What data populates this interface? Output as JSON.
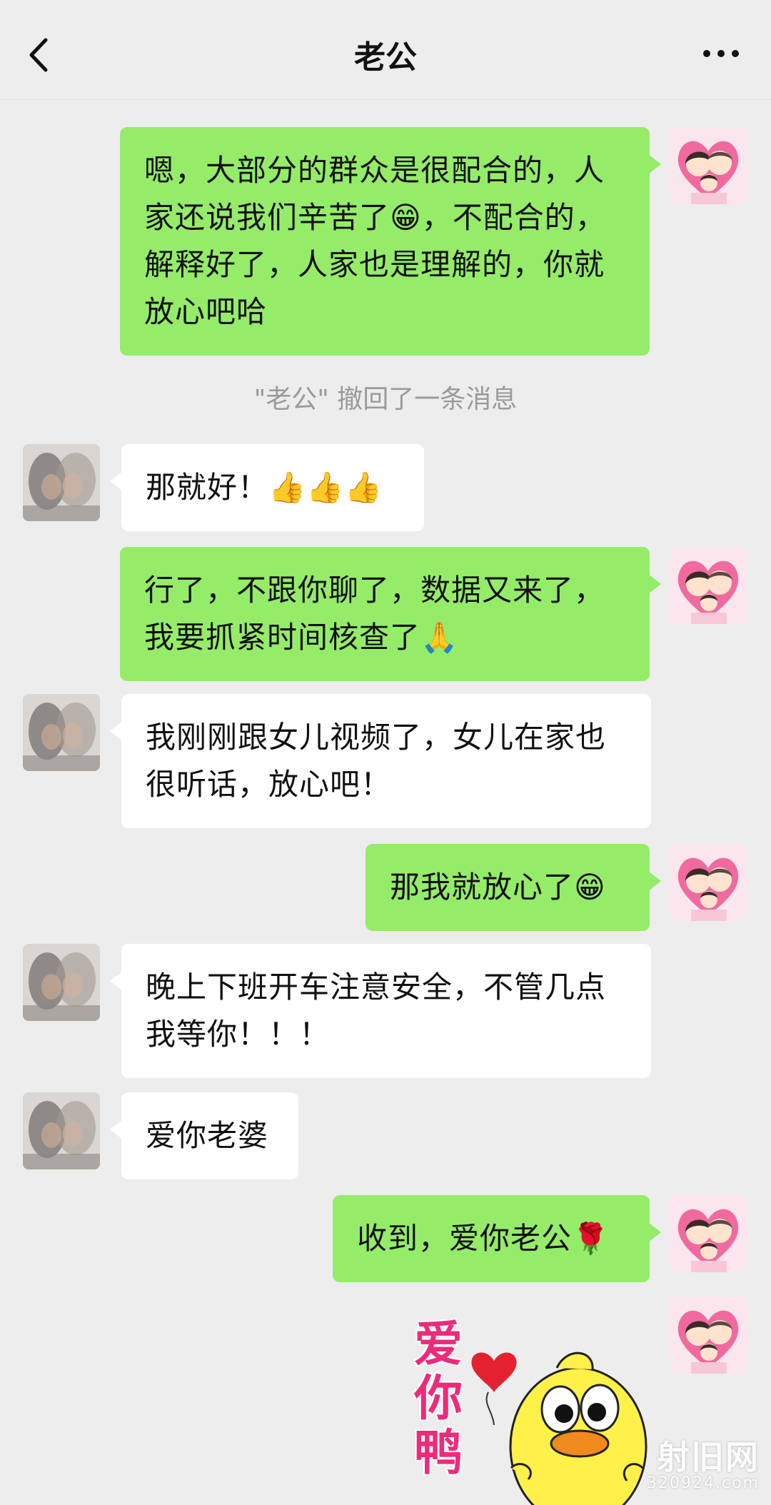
{
  "header": {
    "title": "老公"
  },
  "messages": [
    {
      "side": "me",
      "text": "嗯，大部分的群众是很配合的，人家还说我们辛苦了😁，不配合的，解释好了，人家也是理解的，你就放心吧哈"
    },
    {
      "side": "system",
      "text": "\"老公\" 撤回了一条消息"
    },
    {
      "side": "other",
      "text": "那就好！👍👍👍"
    },
    {
      "side": "me",
      "text": "行了，不跟你聊了，数据又来了，我要抓紧时间核查了🙏"
    },
    {
      "side": "other",
      "text": "我刚刚跟女儿视频了，女儿在家也很听话，放心吧！"
    },
    {
      "side": "me",
      "text": "那我就放心了😁"
    },
    {
      "side": "other",
      "text": "晚上下班开车注意安全，不管几点我等你！！！"
    },
    {
      "side": "other",
      "text": "爱你老婆"
    },
    {
      "side": "me",
      "text": "收到，爱你老公🌹"
    }
  ],
  "sticker": {
    "text": "爱你鸭"
  },
  "watermark": {
    "line1": "射旧网",
    "line2": "320924.com"
  },
  "colors": {
    "me_bubble": "#95ec69",
    "other_bubble": "#ffffff",
    "background": "#ededed"
  },
  "icons": {
    "back": "chevron-left-icon",
    "more": "more-dots-icon"
  }
}
